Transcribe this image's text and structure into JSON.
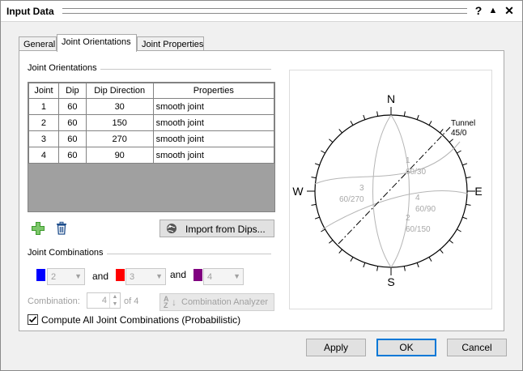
{
  "window": {
    "title": "Input Data",
    "help_glyph": "?",
    "pin_glyph": "▲",
    "close_glyph": "✕"
  },
  "tabs": [
    {
      "label": "General"
    },
    {
      "label": "Joint Orientations"
    },
    {
      "label": "Joint Properties"
    }
  ],
  "joint_orientations": {
    "group_label": "Joint Orientations",
    "columns": [
      "Joint",
      "Dip",
      "Dip Direction",
      "Properties"
    ],
    "rows": [
      {
        "joint": "1",
        "dip": "60",
        "dip_direction": "30",
        "properties": "smooth joint"
      },
      {
        "joint": "2",
        "dip": "60",
        "dip_direction": "150",
        "properties": "smooth joint"
      },
      {
        "joint": "3",
        "dip": "60",
        "dip_direction": "270",
        "properties": "smooth joint"
      },
      {
        "joint": "4",
        "dip": "60",
        "dip_direction": "90",
        "properties": "smooth joint"
      }
    ],
    "import_label": "Import from Dips..."
  },
  "joint_combinations": {
    "group_label": "Joint Combinations",
    "combo1_value": "2",
    "and1": "and",
    "combo2_value": "3",
    "and2": "and",
    "combo3_value": "4",
    "swatch_colors": [
      "#0000ff",
      "#ff0000",
      "#800080"
    ],
    "combination_label": "Combination:",
    "combination_value": "4",
    "of_label": "of 4",
    "analyzer_label": "Combination Analyzer",
    "compute_all_label": "Compute All Joint Combinations (Probabilistic)",
    "compute_all_checked": true
  },
  "stereonet": {
    "north": "N",
    "south": "S",
    "east": "E",
    "west": "W",
    "tunnel_label": "Tunnel",
    "tunnel_value": "45/0",
    "plane_labels": [
      {
        "id": "1",
        "orientation": "60/30"
      },
      {
        "id": "2",
        "orientation": "60/150"
      },
      {
        "id": "3",
        "orientation": "60/270"
      },
      {
        "id": "4",
        "orientation": "60/90"
      }
    ]
  },
  "footer": {
    "apply_label": "Apply",
    "ok_label": "OK",
    "cancel_label": "Cancel"
  },
  "colors": {
    "accent": "#0078d7",
    "grid_empty": "#a0a0a0",
    "add_icon": "#3c9a2c"
  }
}
